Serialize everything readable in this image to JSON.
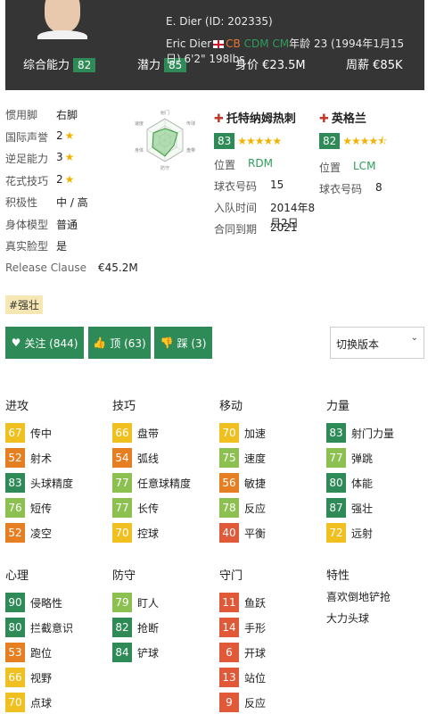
{
  "header": {
    "name": "E. Dier (ID: 202335)",
    "full_name": "Eric Dier",
    "pos1": "CB",
    "pos2": "CDM",
    "pos3": "CM",
    "age_text": "年龄 23 (1994年1月15",
    "line2": "日) 6'2\" 198lbs",
    "overall_label": "综合能力",
    "overall": "82",
    "potential_label": "潜力",
    "potential": "85",
    "value_label": "身价",
    "value": "€23.5M",
    "wage_label": "周薪",
    "wage": "€85K"
  },
  "info": [
    {
      "k": "惯用脚",
      "v": "右脚",
      "star": false
    },
    {
      "k": "国际声誉",
      "v": "2",
      "star": true
    },
    {
      "k": "逆足能力",
      "v": "3",
      "star": true
    },
    {
      "k": "花式技巧",
      "v": "2",
      "star": true
    },
    {
      "k": "积极性",
      "v": "中 / 高",
      "star": false
    },
    {
      "k": "身体模型",
      "v": "普通",
      "star": false
    },
    {
      "k": "真实脸型",
      "v": "是",
      "star": false
    }
  ],
  "release_label": "Release Clause",
  "release_value": "€45.2M",
  "radar_labels": [
    "射门",
    "传球",
    "盘带",
    "防守",
    "身体",
    "速度"
  ],
  "clubs": [
    {
      "title": "托特纳姆热刺",
      "rating": "83",
      "stars": "★★★★★",
      "pos_label": "位置",
      "pos": "RDM",
      "kit_label": "球衣号码",
      "kit": "15",
      "joined_label": "入队时间",
      "joined": "2014年8月2日",
      "contract_label": "合同到期",
      "contract": "2021"
    },
    {
      "title": "英格兰",
      "rating": "82",
      "stars": "★★★★⯪",
      "pos_label": "位置",
      "pos": "LCM",
      "kit_label": "球衣号码",
      "kit": "8"
    }
  ],
  "tag": "#强壮",
  "buttons": {
    "follow": "关注 (844)",
    "up": "顶 (63)",
    "down": "踩 (3)",
    "version": "切换版本"
  },
  "groups": [
    {
      "title": "进攻",
      "attrs": [
        [
          "67",
          "传中"
        ],
        [
          "52",
          "射术"
        ],
        [
          "83",
          "头球精度"
        ],
        [
          "76",
          "短传"
        ],
        [
          "52",
          "凌空"
        ]
      ]
    },
    {
      "title": "技巧",
      "attrs": [
        [
          "66",
          "盘带"
        ],
        [
          "54",
          "弧线"
        ],
        [
          "77",
          "任意球精度"
        ],
        [
          "77",
          "长传"
        ],
        [
          "70",
          "控球"
        ]
      ]
    },
    {
      "title": "移动",
      "attrs": [
        [
          "70",
          "加速"
        ],
        [
          "75",
          "速度"
        ],
        [
          "56",
          "敏捷"
        ],
        [
          "78",
          "反应"
        ],
        [
          "40",
          "平衡"
        ]
      ]
    },
    {
      "title": "力量",
      "attrs": [
        [
          "83",
          "射门力量"
        ],
        [
          "77",
          "弹跳"
        ],
        [
          "80",
          "体能"
        ],
        [
          "87",
          "强壮"
        ],
        [
          "72",
          "远射"
        ]
      ]
    },
    {
      "title": "心理",
      "attrs": [
        [
          "90",
          "侵略性"
        ],
        [
          "80",
          "拦截意识"
        ],
        [
          "53",
          "跑位"
        ],
        [
          "66",
          "视野"
        ],
        [
          "70",
          "点球"
        ]
      ]
    },
    {
      "title": "防守",
      "attrs": [
        [
          "79",
          "盯人"
        ],
        [
          "82",
          "抢断"
        ],
        [
          "84",
          "铲球"
        ]
      ]
    },
    {
      "title": "守门",
      "attrs": [
        [
          "11",
          "鱼跃"
        ],
        [
          "14",
          "手形"
        ],
        [
          "6",
          "开球"
        ],
        [
          "13",
          "站位"
        ],
        [
          "9",
          "反应"
        ]
      ]
    },
    {
      "title": "特性",
      "traits": [
        "喜欢倒地铲抢",
        "大力头球"
      ]
    }
  ],
  "colors": {
    "dark_green": "#2e8b57",
    "light_green": "#8cc152",
    "yellow": "#f0c020",
    "orange": "#e67e22",
    "red": "#e05a3a"
  }
}
